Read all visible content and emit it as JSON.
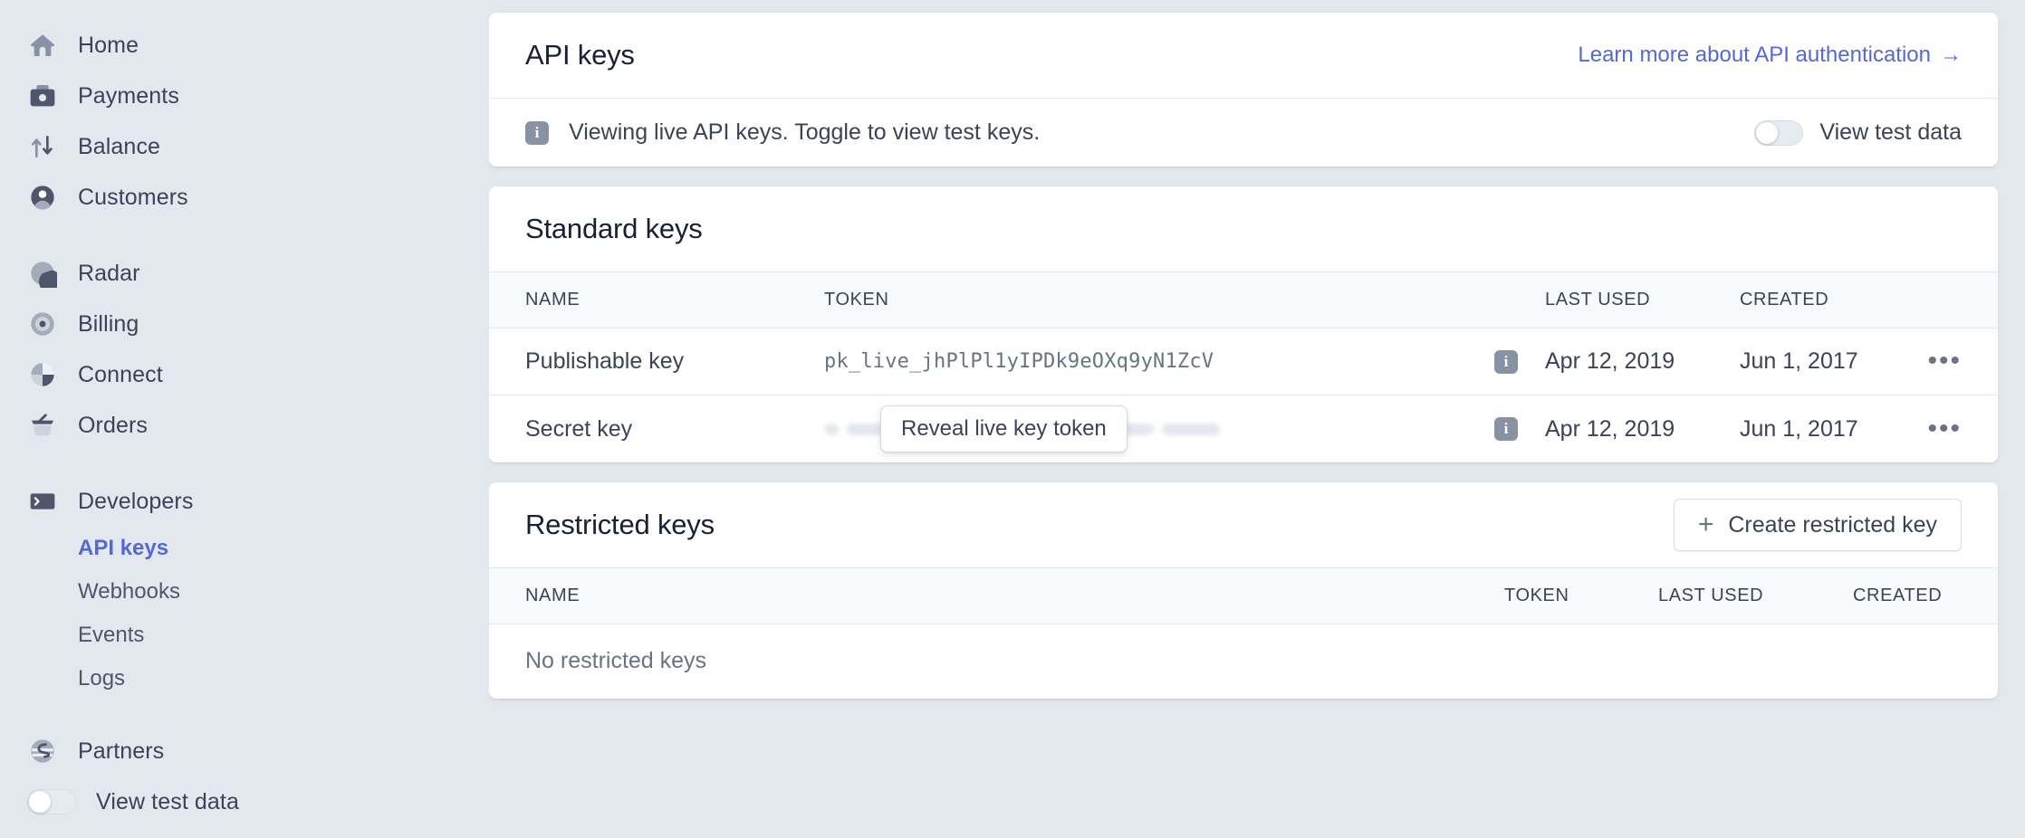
{
  "sidebar": {
    "groups": [
      {
        "items": [
          {
            "label": "Home",
            "icon": "home-icon"
          },
          {
            "label": "Payments",
            "icon": "payments-icon"
          },
          {
            "label": "Balance",
            "icon": "balance-icon"
          },
          {
            "label": "Customers",
            "icon": "customers-icon"
          }
        ]
      },
      {
        "items": [
          {
            "label": "Radar",
            "icon": "radar-icon"
          },
          {
            "label": "Billing",
            "icon": "billing-icon"
          },
          {
            "label": "Connect",
            "icon": "connect-icon"
          },
          {
            "label": "Orders",
            "icon": "orders-icon"
          }
        ]
      },
      {
        "items": [
          {
            "label": "Developers",
            "icon": "terminal-icon"
          }
        ]
      }
    ],
    "developer_subitems": [
      {
        "label": "API keys",
        "active": true
      },
      {
        "label": "Webhooks",
        "active": false
      },
      {
        "label": "Events",
        "active": false
      },
      {
        "label": "Logs",
        "active": false
      }
    ],
    "partners": {
      "label": "Partners",
      "icon": "partners-icon"
    },
    "test_data_toggle": {
      "label": "View test data",
      "state": "off"
    },
    "active_color": "#5469d4"
  },
  "main": {
    "api_keys_card": {
      "title": "API keys",
      "learn_more_label": "Learn more about API authentication",
      "learn_more_arrow": "→",
      "banner": {
        "icon": "info-icon",
        "text": "Viewing live API keys. Toggle to view test keys.",
        "toggle_label": "View test data",
        "toggle_state": "off"
      }
    },
    "standard_keys_card": {
      "title": "Standard keys",
      "columns": {
        "name": "NAME",
        "token": "TOKEN",
        "last_used": "LAST USED",
        "created": "CREATED"
      },
      "rows": [
        {
          "name": "Publishable key",
          "token": "pk_live_jhPlPl1yIPDk9eOXq9yN1ZcV",
          "token_masked": false,
          "info_icon": "info-icon",
          "last_used": "Apr 12, 2019",
          "created": "Jun 1, 2017",
          "menu": "•••"
        },
        {
          "name": "Secret key",
          "token": "",
          "token_masked": true,
          "tooltip": "Reveal live key token",
          "info_icon": "info-icon",
          "last_used": "Apr 12, 2019",
          "created": "Jun 1, 2017",
          "menu": "•••"
        }
      ]
    },
    "restricted_keys_card": {
      "title": "Restricted keys",
      "create_button": {
        "label": "Create restricted key",
        "icon": "plus-icon"
      },
      "columns": {
        "name": "NAME",
        "token": "TOKEN",
        "last_used": "LAST USED",
        "created": "CREATED"
      },
      "empty_text": "No restricted keys"
    }
  }
}
